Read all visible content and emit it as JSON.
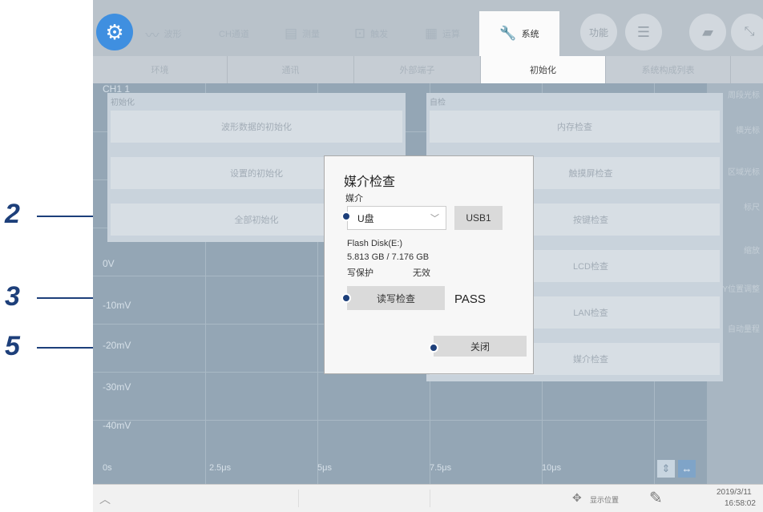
{
  "topbar": {
    "tabs": [
      "波形",
      "CH通道",
      "测量",
      "触发",
      "运算",
      "系统"
    ],
    "func_label": "功能"
  },
  "subtabs": [
    "环境",
    "通讯",
    "外部端子",
    "初始化",
    "系统构成列表"
  ],
  "plot": {
    "ch_label": "CH1 1",
    "y_labels": [
      "0V",
      "-10mV",
      "-20mV",
      "-30mV",
      "-40mV"
    ],
    "x_labels": [
      "0s",
      "2.5μs",
      "5μs",
      "7.5μs",
      "10μs"
    ]
  },
  "right_panel": [
    "周段光标",
    "横光标",
    "区域光标",
    "标尺",
    "缩放",
    "Y位置调整",
    "自动量程"
  ],
  "init_panel": {
    "title": "初始化",
    "buttons": [
      "波形数据的初始化",
      "设置的初始化",
      "全部初始化"
    ]
  },
  "selfcheck_panel": {
    "title": "自检",
    "buttons": [
      "内存检查",
      "触摸屏检查",
      "按键检查",
      "LCD检查",
      "LAN检查",
      "媒介检查"
    ]
  },
  "dialog": {
    "title": "媒介检查",
    "media_label": "媒介",
    "media_value": "U盘",
    "usb_button": "USB1",
    "disk_name": "Flash Disk(E:)",
    "capacity": "5.813 GB / 7.176 GB",
    "write_protect_label": "写保护",
    "write_protect_value": "无效",
    "rw_check_button": "读写检查",
    "result": "PASS",
    "close_button": "关闭"
  },
  "callouts": {
    "n2": "2",
    "n3": "3",
    "n5": "5"
  },
  "statusbar": {
    "display_position": "显示位置",
    "date": "2019/3/11",
    "time": "16:58:02"
  }
}
